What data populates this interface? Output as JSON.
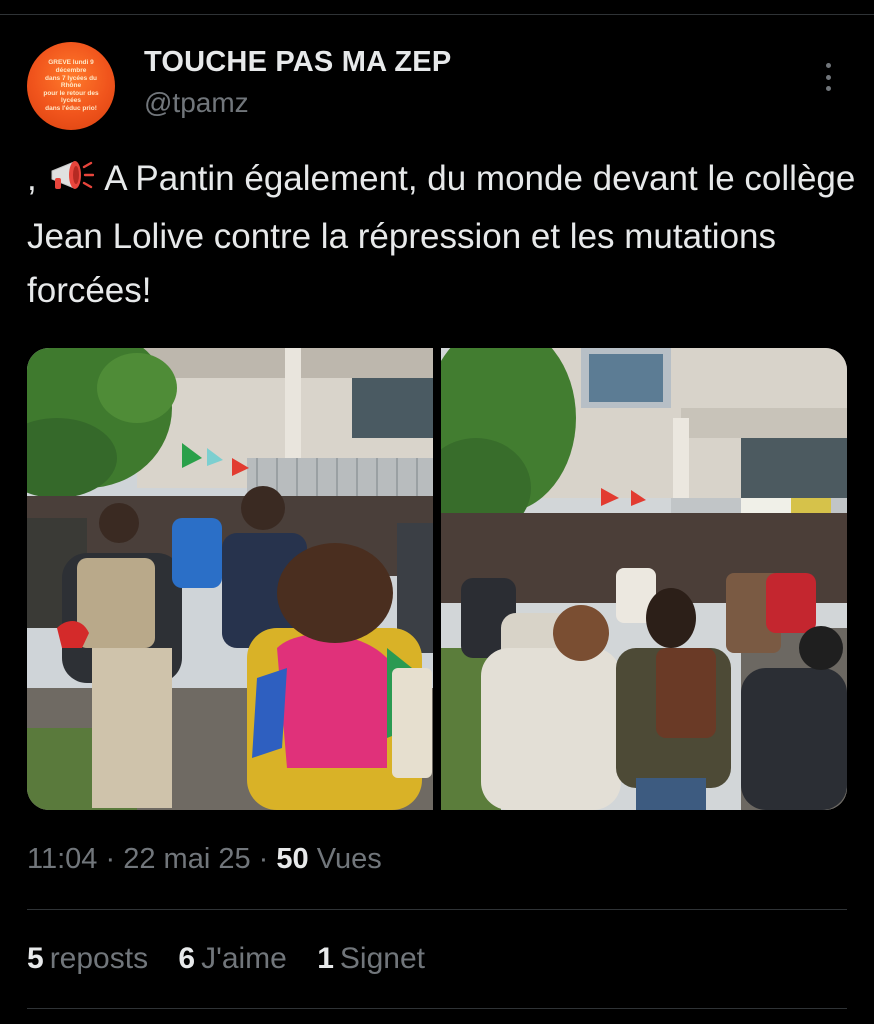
{
  "author": {
    "display_name": "TOUCHE PAS MA ZEP",
    "handle": "@tpamz",
    "avatar_text": "GREVE lundi 9\ndécembre\ndans 7 lycées du\nRhône\npour le retour des\nlycées\ndans l'éduc prio!",
    "avatar_color": "#f0541c"
  },
  "tweet": {
    "prefix": ",",
    "icon": "megaphone-icon",
    "text": "A Pantin également, du monde devant le collège Jean Lolive contre la répression et les mutations forcées!"
  },
  "media": {
    "count": 2
  },
  "meta": {
    "time": "11:04",
    "dot": "·",
    "date": "22 mai 25",
    "views_count": "50",
    "views_label": "Vues"
  },
  "stats": {
    "reposts_count": "5",
    "reposts_label": "reposts",
    "likes_count": "6",
    "likes_label": "J'aime",
    "bookmarks_count": "1",
    "bookmarks_label": "Signet"
  },
  "colors": {
    "background": "#000000",
    "text_primary": "#e7e9ea",
    "text_secondary": "#71767b",
    "divider": "#2f3336"
  }
}
